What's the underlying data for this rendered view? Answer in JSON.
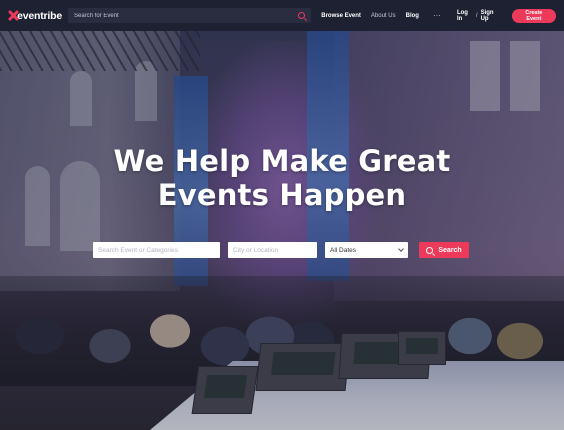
{
  "brand": {
    "name": "eventribe",
    "accent": "#ee3a5a",
    "nav_bg": "#1e2132"
  },
  "navbar": {
    "search_placeholder": "Search for Event",
    "links": [
      "Browse Event",
      "About Us",
      "Blog"
    ],
    "more": "···",
    "login": "Log In",
    "separator": "/",
    "signup": "Sign Up",
    "create": "Create Event"
  },
  "hero": {
    "headline_line1": "We Help Make Great",
    "headline_line2": "Events Happen",
    "search": {
      "keyword_placeholder": "Search Event or Categories",
      "location_placeholder": "City or Location",
      "dates_selected": "All Dates",
      "button": "Search"
    }
  },
  "icons": {
    "logo": "x-mark-icon",
    "nav_search": "search-icon",
    "dates": "chevron-down-icon",
    "hero_search": "search-icon"
  }
}
